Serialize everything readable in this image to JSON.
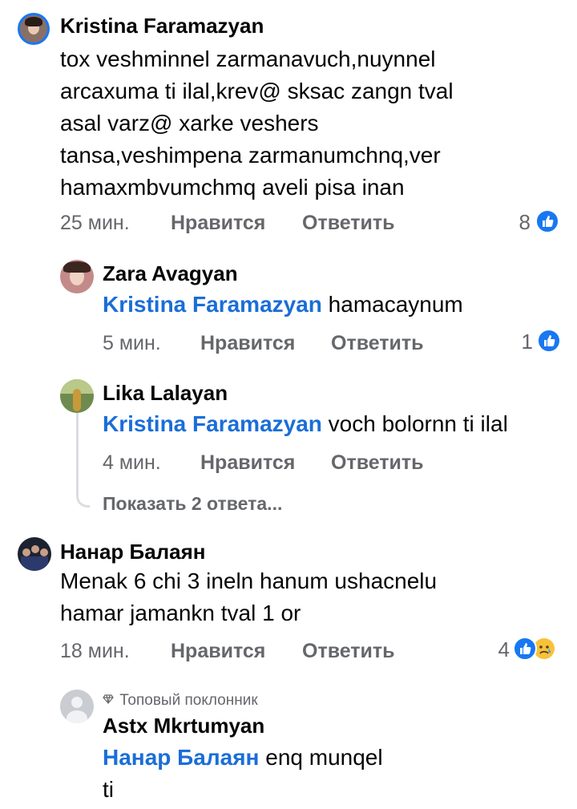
{
  "comments": [
    {
      "author": "Kristina Faramazyan",
      "lines": [
        "tox veshminnel zarmanavuch,nuynnel",
        "arcaxuma ti ilal,krev@ sksac zangn tval",
        "asal varz@ xarke veshers",
        "tansa,veshimpena zarmanumchnq,ver",
        "hamaxmbvumchmq aveli pisa inan"
      ],
      "time": "25 мин.",
      "like": "Нравится",
      "reply": "Ответить",
      "reactions": "8"
    },
    {
      "author": "Zara Avagyan",
      "mention": "Kristina Faramazyan",
      "text": " hamacaynum",
      "time": "5 мин.",
      "like": "Нравится",
      "reply": "Ответить",
      "reactions": "1"
    },
    {
      "author": "Lika Lalayan",
      "mention": "Kristina Faramazyan",
      "text": " voch bolornn ti ilal",
      "time": "4 мин.",
      "like": "Нравится",
      "reply": "Ответить"
    },
    {
      "author": "Нанар Балаян",
      "lines": [
        "Menak 6 chi 3 ineln hanum ushacnelu",
        "hamar jamankn tval 1 or"
      ],
      "time": "18 мин.",
      "like": "Нравится",
      "reply": "Ответить",
      "reactions": "4"
    },
    {
      "author": "Astx Mkrtumyan",
      "badge": "Топовый поклонник",
      "mention": "Нанар Балаян",
      "text": " enq munqel",
      "text2": "ti"
    }
  ],
  "show_replies": "Показать 2 ответа...",
  "colors": {
    "link": "#1a6ed8",
    "meta": "#65676b",
    "like": "#1877f2"
  }
}
